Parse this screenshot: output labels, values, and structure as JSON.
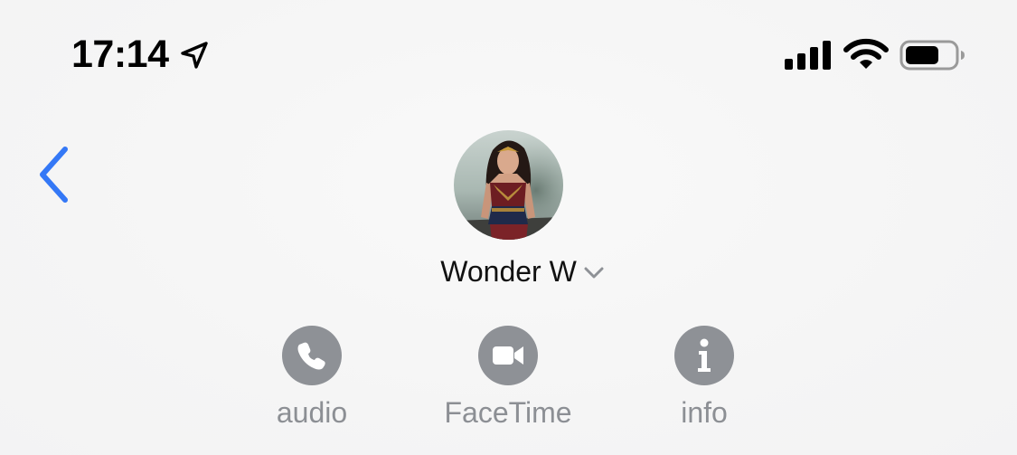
{
  "status_bar": {
    "time": "17:14",
    "icons": [
      "location-arrow-icon",
      "cellular-signal-icon",
      "wifi-icon",
      "battery-icon"
    ]
  },
  "header": {
    "back_icon": "chevron-left-icon",
    "contact_name": "Wonder W",
    "name_chevron_icon": "chevron-down-icon",
    "avatar": "contact-photo"
  },
  "actions": [
    {
      "label": "audio",
      "icon": "phone-icon"
    },
    {
      "label": "FaceTime",
      "icon": "video-camera-icon"
    },
    {
      "label": "info",
      "icon": "info-icon"
    }
  ],
  "colors": {
    "accent": "#3478f6",
    "background": "#f6f6f6",
    "action_gray": "#8e9196",
    "label_gray": "#8c8f94"
  }
}
